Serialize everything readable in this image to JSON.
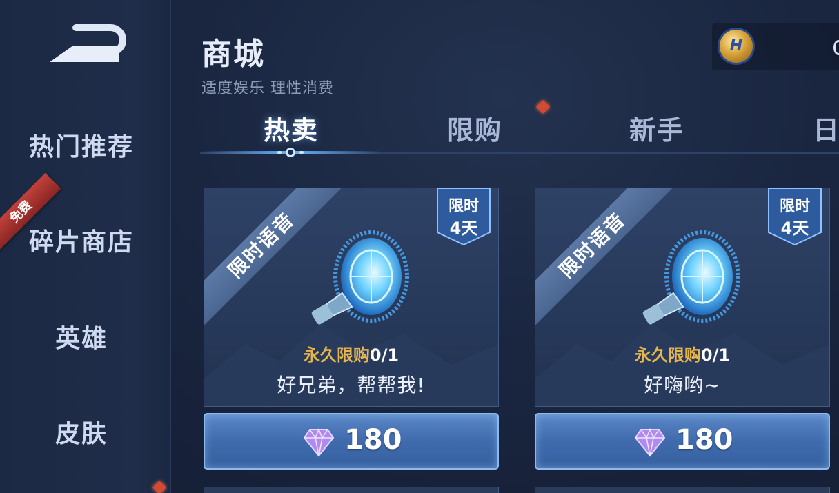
{
  "header": {
    "title": "商城",
    "subtitle": "适度娱乐 理性消费"
  },
  "sidebar": {
    "items": [
      {
        "label": "热门推荐"
      },
      {
        "label": "碎片商店",
        "tag": "免费"
      },
      {
        "label": "英雄"
      },
      {
        "label": "皮肤"
      }
    ]
  },
  "currency": {
    "icon": "coupon-coin-icon",
    "symbol": "H"
  },
  "tabs": [
    {
      "label": "热卖",
      "active": true
    },
    {
      "label": "限购"
    },
    {
      "label": "新手"
    },
    {
      "label": "日"
    }
  ],
  "products": [
    {
      "ribbon": "限时语音",
      "badge_line1": "限时",
      "badge_line2": "4天",
      "limit_label": "永久限购",
      "limit_count": "0/1",
      "name": "好兄弟，帮帮我!",
      "price": "180",
      "icon": "speaker-icon"
    },
    {
      "ribbon": "限时语音",
      "badge_line1": "限时",
      "badge_line2": "4天",
      "limit_label": "永久限购",
      "limit_count": "0/1",
      "name": "好嗨哟~",
      "price": "180",
      "icon": "speaker-icon"
    }
  ],
  "colors": {
    "accent_blue": "#69b4ff",
    "limit_gold": "#e6b54e",
    "free_red": "#c2413a",
    "button_blue": "#3f6bad"
  }
}
